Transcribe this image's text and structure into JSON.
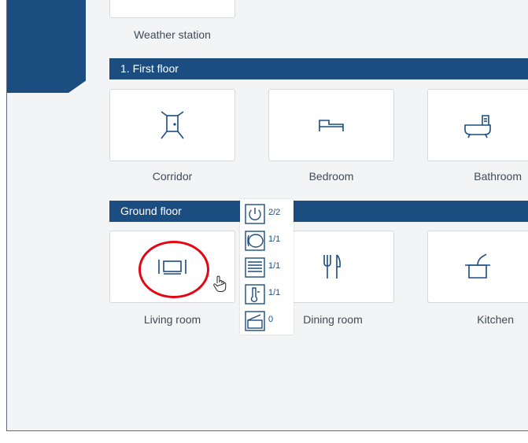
{
  "weather": {
    "label": "Weather station"
  },
  "sections": {
    "first_floor": "1. First floor",
    "ground_floor": "Ground floor"
  },
  "rooms": {
    "corridor": "Corridor",
    "bedroom": "Bedroom",
    "bathroom": "Bathroom",
    "living_room": "Living room",
    "dining_room": "Dining room",
    "kitchen": "Kitchen"
  },
  "status_popup": {
    "lights": "2/2",
    "shading": "1/1",
    "blinds": "1/1",
    "temperature": "1/1",
    "windows": "0"
  },
  "colors": {
    "accent": "#1c4d80",
    "highlight": "#e30613",
    "background": "#f3f4f5"
  }
}
